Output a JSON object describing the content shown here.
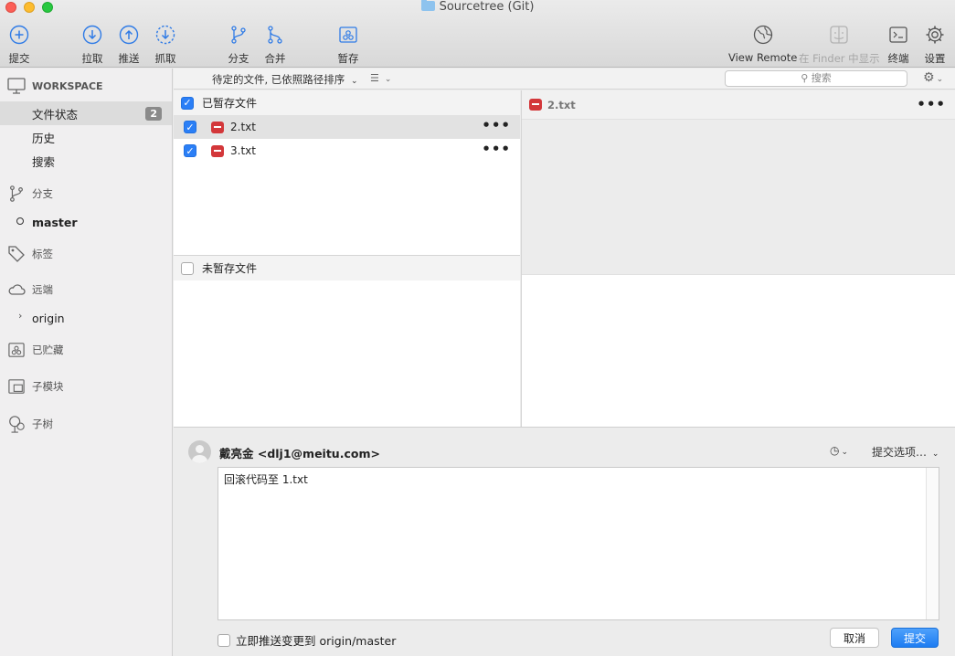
{
  "window": {
    "title": "Sourcetree (Git)"
  },
  "toolbar": {
    "commit": "提交",
    "pull": "拉取",
    "push": "推送",
    "fetch": "抓取",
    "branch": "分支",
    "merge": "合并",
    "stash": "暂存",
    "view_remote": "View Remote",
    "show_in_finder": "在 Finder 中显示",
    "terminal": "终端",
    "settings": "设置"
  },
  "sidebar": {
    "workspace": "WORKSPACE",
    "file_status": "文件状态",
    "file_status_count": "2",
    "history": "历史",
    "search": "搜索",
    "branches": "分支",
    "master": "master",
    "tags": "标签",
    "remotes": "远端",
    "origin": "origin",
    "stashes": "已贮藏",
    "submodules": "子模块",
    "subtrees": "子树"
  },
  "filterbar": {
    "sort": "待定的文件, 已依照路径排序",
    "search_placeholder": "搜索"
  },
  "staged": {
    "header": "已暂存文件",
    "files": [
      {
        "name": "2.txt",
        "status": "removed"
      },
      {
        "name": "3.txt",
        "status": "removed"
      }
    ]
  },
  "unstaged": {
    "header": "未暂存文件"
  },
  "diff": {
    "filename": "2.txt"
  },
  "commit": {
    "author": "戴亮金 <dlj1@meitu.com>",
    "options": "提交选项…",
    "message": "回滚代码至 1.txt",
    "push_option": "立即推送变更到 origin/master",
    "cancel": "取消",
    "submit": "提交"
  },
  "colors": {
    "accent": "#2b7ff6",
    "removed": "#d3373a"
  }
}
